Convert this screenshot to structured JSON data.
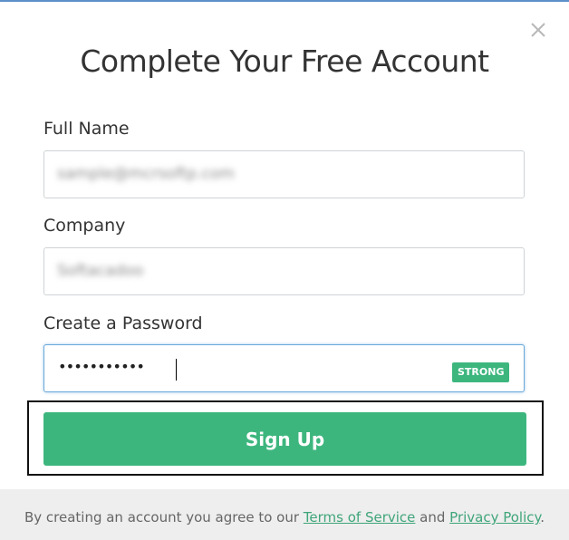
{
  "dialog": {
    "title": "Complete Your Free Account",
    "close_icon": "close-icon"
  },
  "form": {
    "full_name": {
      "label": "Full Name",
      "value": "sample@mcrsoftp.com"
    },
    "company": {
      "label": "Company",
      "value": "Softacadoo"
    },
    "password": {
      "label": "Create a Password",
      "value": "•••••••••••",
      "strength": "STRONG"
    },
    "submit_label": "Sign Up"
  },
  "footer": {
    "text_before": "By creating an account you agree to our ",
    "terms_label": "Terms of Service",
    "text_middle": " and ",
    "privacy_label": "Privacy Policy",
    "text_after": "."
  },
  "colors": {
    "accent": "#3db67e",
    "link": "#3fa57a",
    "focus_border": "#6aa9da",
    "footer_bg": "#eeeeee"
  }
}
